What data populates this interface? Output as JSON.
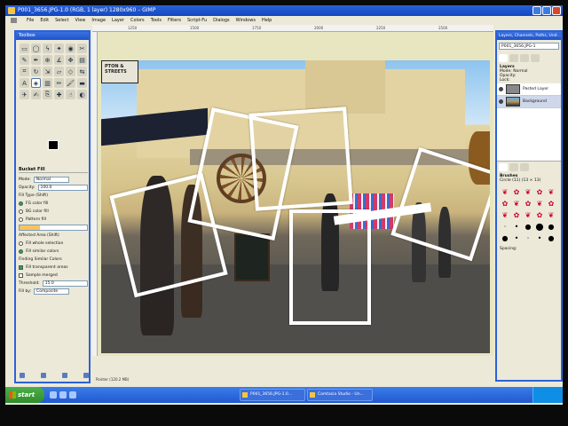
{
  "window": {
    "title": "P001_3656.JPG-1.0 (RGB, 1 layer) 1280x960 – GIMP"
  },
  "menubar": [
    "File",
    "Edit",
    "Select",
    "View",
    "Image",
    "Layer",
    "Colors",
    "Tools",
    "Filters",
    "Script-Fu",
    "Dialogs",
    "Windows",
    "Help"
  ],
  "ruler": {
    "ticks": [
      "1250",
      "1500",
      "1750",
      "2000",
      "2250",
      "2500"
    ]
  },
  "statusbar": {
    "text": "Pointer (120.2 MB)"
  },
  "photo": {
    "sign_text": "PTON & STREETS"
  },
  "toolbox": {
    "title": "Toolbox",
    "tools": [
      "rect-select",
      "ellipse-select",
      "free-select",
      "fuzzy-select",
      "color-select",
      "scissors",
      "paths",
      "color-picker",
      "zoom",
      "measure",
      "move",
      "align",
      "crop",
      "rotate",
      "scale",
      "shear",
      "perspective",
      "flip",
      "text",
      "bucket-fill",
      "blend",
      "pencil",
      "paintbrush",
      "eraser",
      "airbrush",
      "ink",
      "clone",
      "heal",
      "smudge",
      "dodge"
    ],
    "options": {
      "header": "Bucket Fill",
      "mode_label": "Mode:",
      "mode_value": "Normal",
      "opacity_label": "Opacity:",
      "opacity_value": "100.0",
      "fill_type_label": "Fill Type (Shift)",
      "fill_fg": "FG color fill",
      "fill_bg": "BG color fill",
      "fill_pattern": "Pattern fill",
      "affected_label": "Affected Area (Shift)",
      "affected_selection": "Fill whole selection",
      "affected_similar": "Fill similar colors",
      "finding_label": "Finding Similar Colors",
      "fill_transparent": "Fill transparent areas",
      "sample_merged": "Sample merged",
      "threshold_label": "Threshold:",
      "threshold_value": "15.0",
      "fill_by_label": "Fill by:",
      "fill_by_value": "Composite"
    }
  },
  "dock": {
    "title": "Layers, Channels, Paths, Und...",
    "image_select": "P001_3656.JPG-1",
    "layers_label": "Layers",
    "mode_label": "Mode:",
    "mode_value": "Normal",
    "opacity_label": "Opacity:",
    "lock_label": "Lock:",
    "layers": [
      {
        "name": "Pasted Layer"
      },
      {
        "name": "Background"
      }
    ],
    "brushes_label": "Brushes",
    "brush_info": "Circle (11) (13 × 13)",
    "spacing_label": "Spacing:"
  },
  "taskbar": {
    "start": "start",
    "tasks": [
      "P001_3656.JPG-1.0...",
      "Camtasia Studio - Un..."
    ]
  }
}
